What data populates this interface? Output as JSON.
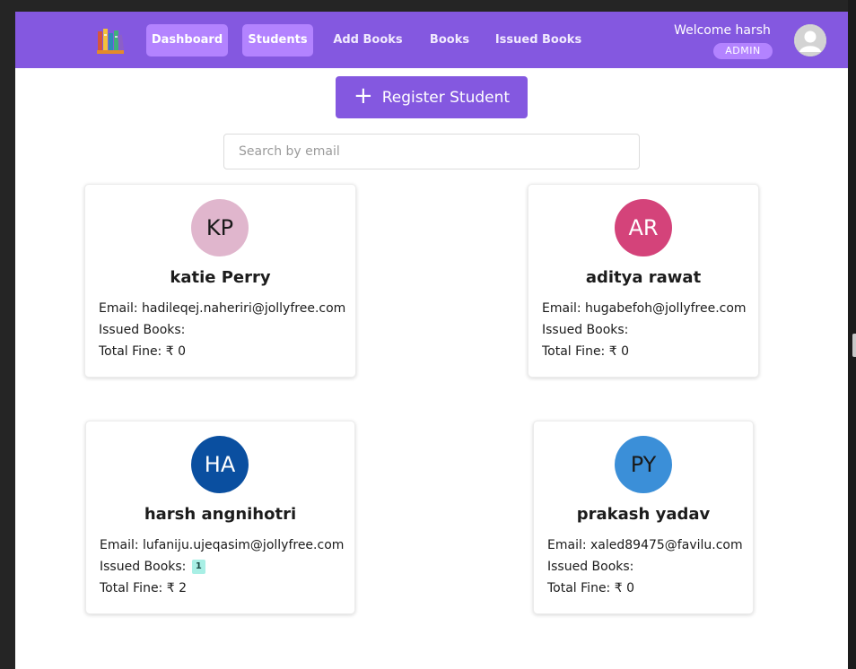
{
  "nav": {
    "items": [
      {
        "label": "Dashboard",
        "active": true
      },
      {
        "label": "Students",
        "active": true
      },
      {
        "label": "Add Books",
        "active": false
      },
      {
        "label": "Books",
        "active": false
      },
      {
        "label": "Issued Books",
        "active": false
      }
    ],
    "welcome": "Welcome harsh",
    "role": "ADMIN"
  },
  "actions": {
    "register_label": "Register Student"
  },
  "search": {
    "placeholder": "Search by email",
    "value": ""
  },
  "students": [
    {
      "initials": "KP",
      "avatar_color": "#e0b6cd",
      "initials_color": "#1a1a1a",
      "name": "katie Perry",
      "email_label": "Email:",
      "email": "hadileqej.naheriri@jollyfree.com",
      "books_label": "Issued Books:",
      "issued_count": "",
      "fine_label": "Total Fine:",
      "fine": "₹ 0"
    },
    {
      "initials": "AR",
      "avatar_color": "#d4437a",
      "initials_color": "#ffffff",
      "name": "aditya rawat",
      "email_label": "Email:",
      "email": "hugabefoh@jollyfree.com",
      "books_label": "Issued Books:",
      "issued_count": "",
      "fine_label": "Total Fine:",
      "fine": "₹ 0"
    },
    {
      "initials": "HA",
      "avatar_color": "#0a4fa0",
      "initials_color": "#ffffff",
      "name": "harsh angnihotri",
      "email_label": "Email:",
      "email": "lufaniju.ujeqasim@jollyfree.com",
      "books_label": "Issued Books:",
      "issued_count": "1",
      "fine_label": "Total Fine:",
      "fine": "₹ 2"
    },
    {
      "initials": "PY",
      "avatar_color": "#3b8fd8",
      "initials_color": "#1a1a1a",
      "name": "prakash yadav",
      "email_label": "Email:",
      "email": "xaled89475@favilu.com",
      "books_label": "Issued Books:",
      "issued_count": "",
      "fine_label": "Total Fine:",
      "fine": "₹ 0"
    }
  ],
  "colors": {
    "primary": "#8458e0",
    "nav_active": "#b383ff",
    "badge": "#a8efe5"
  }
}
